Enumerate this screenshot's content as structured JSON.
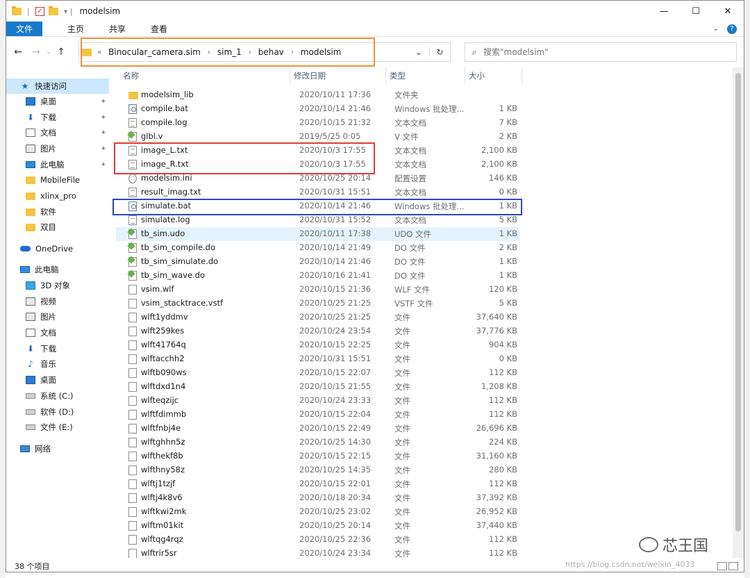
{
  "window": {
    "title": "modelsim",
    "controls": {
      "minimize": "—",
      "maximize": "☐",
      "close": "✕"
    }
  },
  "ribbon": {
    "tabs": [
      "文件",
      "主页",
      "共享",
      "查看"
    ]
  },
  "address": {
    "back": "←",
    "forward": "→",
    "up": "↑",
    "recent": "⌄",
    "overflow": "«",
    "crumbs": [
      "Binocular_camera.sim",
      "sim_1",
      "behav",
      "modelsim"
    ]
  },
  "search": {
    "placeholder": "搜索\"modelsim\""
  },
  "sidebar": {
    "items": [
      {
        "label": "快速访问",
        "icon": "star-icon",
        "active": true
      },
      {
        "label": "桌面",
        "icon": "desktop-icon",
        "pinned": true
      },
      {
        "label": "下载",
        "icon": "download-icon",
        "pinned": true
      },
      {
        "label": "文档",
        "icon": "document-icon",
        "pinned": true
      },
      {
        "label": "图片",
        "icon": "pictures-icon",
        "pinned": true
      },
      {
        "label": "此电脑",
        "icon": "computer-icon",
        "pinned": true
      },
      {
        "label": "MobileFile",
        "icon": "folder-icon"
      },
      {
        "label": "xlinx_pro",
        "icon": "folder-icon"
      },
      {
        "label": "软件",
        "icon": "folder-icon"
      },
      {
        "label": "双目",
        "icon": "folder-icon"
      },
      {
        "label": "OneDrive",
        "icon": "cloud-icon"
      },
      {
        "label": "此电脑",
        "icon": "computer-icon"
      },
      {
        "label": "3D 对象",
        "icon": "3d-objects-icon"
      },
      {
        "label": "视频",
        "icon": "video-icon"
      },
      {
        "label": "图片",
        "icon": "pictures-icon"
      },
      {
        "label": "文档",
        "icon": "document-icon"
      },
      {
        "label": "下载",
        "icon": "download-icon"
      },
      {
        "label": "音乐",
        "icon": "music-icon"
      },
      {
        "label": "桌面",
        "icon": "desktop-icon"
      },
      {
        "label": "系统 (C:)",
        "icon": "drive-icon"
      },
      {
        "label": "软件 (D:)",
        "icon": "drive-icon"
      },
      {
        "label": "文件 (E:)",
        "icon": "drive-icon"
      },
      {
        "label": "网络",
        "icon": "network-icon"
      }
    ]
  },
  "columns": {
    "name": "名称",
    "date": "修改日期",
    "type": "类型",
    "size": "大小"
  },
  "files": [
    {
      "name": "modelsim_lib",
      "date": "2020/10/11 17:36",
      "type": "文件夹",
      "size": "",
      "icon": "folder-icon"
    },
    {
      "name": "compile.bat",
      "date": "2020/10/14 21:46",
      "type": "Windows 批处理...",
      "size": "1 KB",
      "icon": "batch-file-icon"
    },
    {
      "name": "compile.log",
      "date": "2020/10/15 21:32",
      "type": "文本文档",
      "size": "7 KB",
      "icon": "text-file-icon"
    },
    {
      "name": "glbl.v",
      "date": "2019/5/25 0:05",
      "type": "V 文件",
      "size": "2 KB",
      "icon": "verilog-file-icon"
    },
    {
      "name": "image_L.txt",
      "date": "2020/10/3 17:55",
      "type": "文本文档",
      "size": "2,100 KB",
      "icon": "text-file-icon"
    },
    {
      "name": "image_R.txt",
      "date": "2020/10/3 17:55",
      "type": "文本文档",
      "size": "2,100 KB",
      "icon": "text-file-icon"
    },
    {
      "name": "modelsim.ini",
      "date": "2020/10/25 20:14",
      "type": "配置设置",
      "size": "146 KB",
      "icon": "settings-file-icon"
    },
    {
      "name": "result_imag.txt",
      "date": "2020/10/31 15:51",
      "type": "文本文档",
      "size": "0 KB",
      "icon": "text-file-icon"
    },
    {
      "name": "simulate.bat",
      "date": "2020/10/14 21:46",
      "type": "Windows 批处理...",
      "size": "1 KB",
      "icon": "batch-file-icon"
    },
    {
      "name": "simulate.log",
      "date": "2020/10/31 15:52",
      "type": "文本文档",
      "size": "5 KB",
      "icon": "text-file-icon"
    },
    {
      "name": "tb_sim.udo",
      "date": "2020/10/11 17:38",
      "type": "UDO 文件",
      "size": "1 KB",
      "icon": "script-file-icon",
      "highlight": true
    },
    {
      "name": "tb_sim_compile.do",
      "date": "2020/10/14 21:49",
      "type": "DO 文件",
      "size": "2 KB",
      "icon": "script-file-icon"
    },
    {
      "name": "tb_sim_simulate.do",
      "date": "2020/10/14 21:46",
      "type": "DO 文件",
      "size": "1 KB",
      "icon": "script-file-icon"
    },
    {
      "name": "tb_sim_wave.do",
      "date": "2020/10/16 21:41",
      "type": "DO 文件",
      "size": "1 KB",
      "icon": "script-file-icon"
    },
    {
      "name": "vsim.wlf",
      "date": "2020/10/15 21:36",
      "type": "WLF 文件",
      "size": "120 KB",
      "icon": "file-icon"
    },
    {
      "name": "vsim_stacktrace.vstf",
      "date": "2020/10/25 21:25",
      "type": "VSTF 文件",
      "size": "5 KB",
      "icon": "file-icon"
    },
    {
      "name": "wlft1yddmv",
      "date": "2020/10/25 21:25",
      "type": "文件",
      "size": "37,640 KB",
      "icon": "file-icon"
    },
    {
      "name": "wlft259kes",
      "date": "2020/10/24 23:54",
      "type": "文件",
      "size": "37,776 KB",
      "icon": "file-icon"
    },
    {
      "name": "wlft41764q",
      "date": "2020/10/15 22:25",
      "type": "文件",
      "size": "904 KB",
      "icon": "file-icon"
    },
    {
      "name": "wlftacchh2",
      "date": "2020/10/31 15:51",
      "type": "文件",
      "size": "0 KB",
      "icon": "file-icon"
    },
    {
      "name": "wlftb090ws",
      "date": "2020/10/15 22:07",
      "type": "文件",
      "size": "112 KB",
      "icon": "file-icon"
    },
    {
      "name": "wlftdxd1n4",
      "date": "2020/10/15 21:55",
      "type": "文件",
      "size": "1,208 KB",
      "icon": "file-icon"
    },
    {
      "name": "wlfteqzijc",
      "date": "2020/10/24 23:33",
      "type": "文件",
      "size": "112 KB",
      "icon": "file-icon"
    },
    {
      "name": "wlftfdimmb",
      "date": "2020/10/15 22:04",
      "type": "文件",
      "size": "112 KB",
      "icon": "file-icon"
    },
    {
      "name": "wlftfnbj4e",
      "date": "2020/10/15 22:49",
      "type": "文件",
      "size": "26,696 KB",
      "icon": "file-icon"
    },
    {
      "name": "wlftghhn5z",
      "date": "2020/10/25 14:30",
      "type": "文件",
      "size": "224 KB",
      "icon": "file-icon"
    },
    {
      "name": "wlfthekf8b",
      "date": "2020/10/15 22:15",
      "type": "文件",
      "size": "31,160 KB",
      "icon": "file-icon"
    },
    {
      "name": "wlfthny58z",
      "date": "2020/10/25 14:35",
      "type": "文件",
      "size": "280 KB",
      "icon": "file-icon"
    },
    {
      "name": "wlftj1tzjf",
      "date": "2020/10/15 22:01",
      "type": "文件",
      "size": "112 KB",
      "icon": "file-icon"
    },
    {
      "name": "wlftj4k8v6",
      "date": "2020/10/18 20:34",
      "type": "文件",
      "size": "37,392 KB",
      "icon": "file-icon"
    },
    {
      "name": "wlftkwi2mk",
      "date": "2020/10/25 23:02",
      "type": "文件",
      "size": "26,952 KB",
      "icon": "file-icon"
    },
    {
      "name": "wlftm01kit",
      "date": "2020/10/25 20:14",
      "type": "文件",
      "size": "37,440 KB",
      "icon": "file-icon"
    },
    {
      "name": "wlftqg4rqz",
      "date": "2020/10/25 22:36",
      "type": "文件",
      "size": "112 KB",
      "icon": "file-icon"
    },
    {
      "name": "wlftrir5sr",
      "date": "2020/10/24 23:34",
      "type": "文件",
      "size": "112 KB",
      "icon": "file-icon"
    }
  ],
  "status": {
    "count": "38 个项目"
  },
  "watermark": {
    "brand": "芯王国",
    "url": "https://blog.csdn.net/weixin_4033"
  },
  "colors": {
    "accent": "#1979ca",
    "selection": "#cce8ff",
    "orange_box": "#f0913a",
    "red_box": "#e53935",
    "blue_box": "#2c46c7"
  }
}
